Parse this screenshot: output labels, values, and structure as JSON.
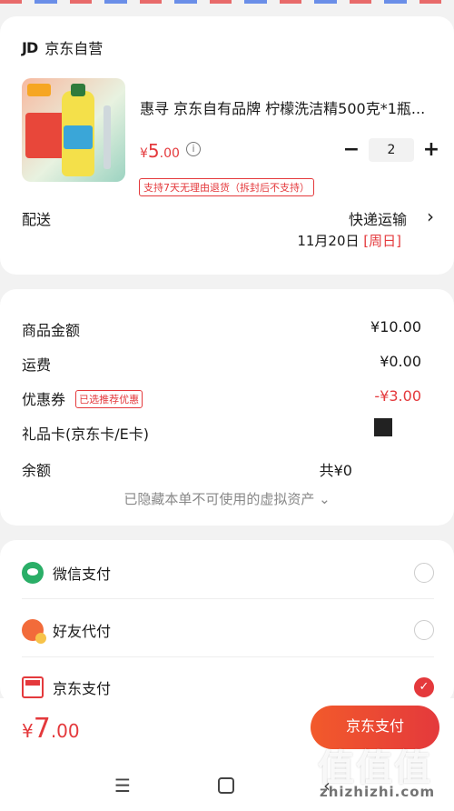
{
  "store": {
    "logo": "JD",
    "name": "京东自营"
  },
  "product": {
    "title": "惠寻 京东自有品牌 柠檬洗洁精500克*1瓶...",
    "price_symbol": "¥",
    "price_int": "5",
    "price_dec": ".00",
    "quantity": "2",
    "minus": "−",
    "plus": "+",
    "return_tag": "支持7天无理由退货（拆封后不支持）"
  },
  "shipping": {
    "label": "配送",
    "method": "快递运输",
    "date": "11月20日",
    "weekday": "[周日]",
    "chevron": "›"
  },
  "summary": {
    "goods_label": "商品金额",
    "goods_value": "¥10.00",
    "freight_label": "运费",
    "freight_value": "¥0.00",
    "coupon_label": "优惠券",
    "coupon_tag": "已选推荐优惠",
    "coupon_value": "-¥3.00",
    "giftcard_label": "礼品卡(京东卡/E卡)",
    "balance_label": "余额",
    "balance_value": "共¥0",
    "hidden_note": "已隐藏本单不可使用的虚拟资产 ⌄"
  },
  "payment": {
    "options": [
      {
        "label": "微信支付",
        "icon": "wechat-icon",
        "selected": false
      },
      {
        "label": "好友代付",
        "icon": "friend-pay-icon",
        "selected": false
      },
      {
        "label": "京东支付",
        "icon": "jd-pay-icon",
        "selected": true
      }
    ]
  },
  "bottom": {
    "total_symbol": "¥",
    "total_int": "7",
    "total_dec": ".00",
    "pay_button": "京东支付"
  },
  "nav": {
    "menu": "☰",
    "back": "‹"
  },
  "watermark": {
    "text": "值值值",
    "url": "zhizhizhi.com"
  },
  "colors": {
    "accent": "#e4393c",
    "wechat": "#2aae67"
  }
}
